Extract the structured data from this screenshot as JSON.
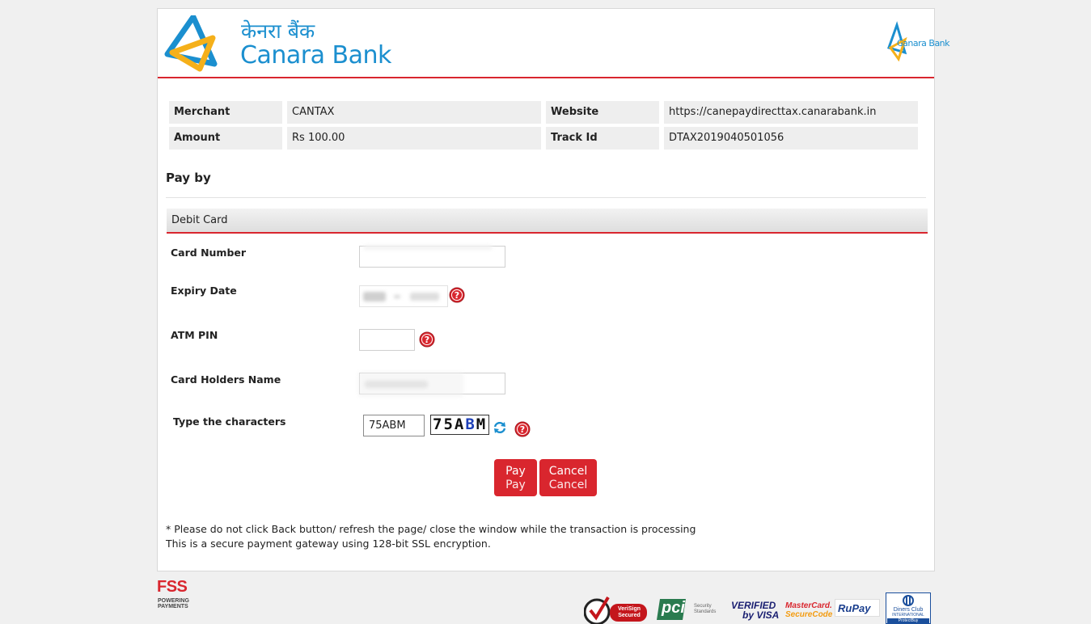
{
  "header": {
    "logo_hindi": "केनरा बैंक",
    "logo_english": "Canara Bank",
    "small_logo_text": "Canara Bank"
  },
  "merchant_info": {
    "merchant_label": "Merchant",
    "merchant_value": "CANTAX",
    "website_label": "Website",
    "website_value": "https://canepaydirecttax.canarabank.in",
    "amount_label": "Amount",
    "amount_value": "Rs 100.00",
    "track_label": "Track Id",
    "track_value": "DTAX2019040501056"
  },
  "payment": {
    "pay_by_label": "Pay by",
    "section_title": "Debit Card",
    "card_number_label": "Card Number",
    "expiry_label": "Expiry Date",
    "atm_pin_label": "ATM PIN",
    "holder_label": "Card Holders Name",
    "captcha_label": "Type the characters",
    "captcha_input_value": "75ABM",
    "captcha_image_text_a": "75A",
    "captcha_image_text_b": "B",
    "captcha_image_text_c": "M"
  },
  "buttons": {
    "pay_label": "Pay",
    "cancel_label": "Cancel"
  },
  "notes": {
    "line1": "* Please do not click Back button/ refresh the page/ close the window while the transaction is processing",
    "line2": "This is a secure payment gateway using 128-bit SSL encryption."
  },
  "footer": {
    "fss_big": "FSS",
    "fss_line1": "POWERING",
    "fss_line2": "PAYMENTS",
    "verisign_line1": "VeriSign",
    "verisign_line2": "Secured",
    "pci": "pci",
    "pci_sub1": "Security",
    "pci_sub2": "Standards",
    "visa_line1": "VERIFIED",
    "visa_line2": "by VISA",
    "mc_line1": "MasterCard.",
    "mc_line2": "SecureCode",
    "rupay": "RuPay",
    "diners_line1": "Diners Club",
    "diners_line2": "INTERNATIONAL",
    "diners_line3": "ProtectBuy"
  },
  "colors": {
    "brand_red": "#d9262e",
    "brand_blue": "#1b8fcf",
    "brand_yellow": "#f5b01a"
  }
}
